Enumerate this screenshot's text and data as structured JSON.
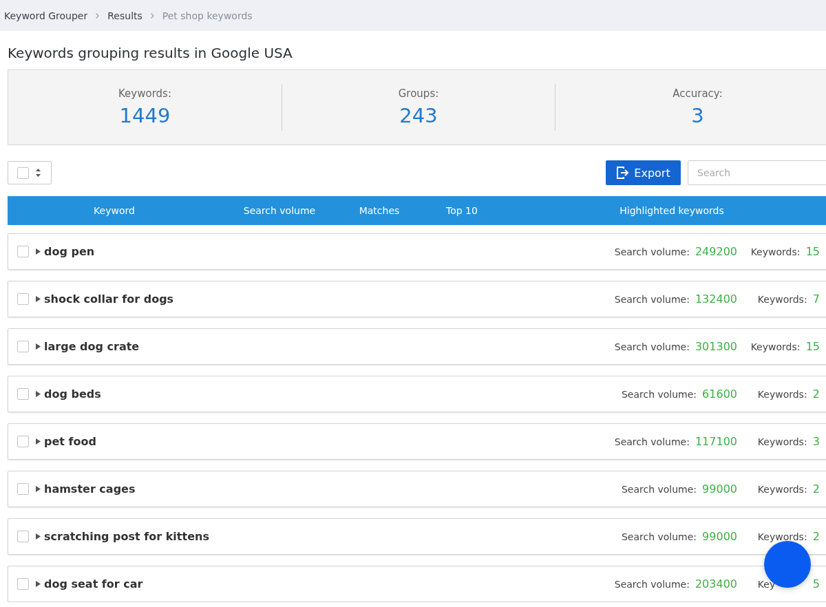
{
  "breadcrumbs": [
    {
      "label": "Keyword Grouper",
      "current": false
    },
    {
      "label": "Results",
      "current": false
    },
    {
      "label": "Pet shop keywords",
      "current": true
    }
  ],
  "title": "Keywords grouping results in Google USA",
  "stats": [
    {
      "label": "Keywords:",
      "value": "1449"
    },
    {
      "label": "Groups:",
      "value": "243"
    },
    {
      "label": "Accuracy:",
      "value": "3"
    }
  ],
  "toolbar": {
    "select_all": {
      "checked": false
    },
    "export_button": "Export",
    "search": {
      "placeholder": "Search"
    }
  },
  "table": {
    "columns": [
      "Keyword",
      "Search volume",
      "Matches",
      "Top 10",
      "Highlighted keywords"
    ],
    "rows": [
      {
        "keyword": "dog pen",
        "checked": false,
        "expanded": false,
        "volume_label": "Search volume:",
        "volume": "249200",
        "keywords_label": "Keywords:",
        "keywords": "15"
      },
      {
        "keyword": "shock collar for dogs",
        "checked": false,
        "expanded": false,
        "volume_label": "Search volume:",
        "volume": "132400",
        "keywords_label": "Keywords:",
        "keywords": "7"
      },
      {
        "keyword": "large dog crate",
        "checked": false,
        "expanded": false,
        "volume_label": "Search volume:",
        "volume": "301300",
        "keywords_label": "Keywords:",
        "keywords": "15"
      },
      {
        "keyword": "dog beds",
        "checked": false,
        "expanded": false,
        "volume_label": "Search volume:",
        "volume": "61600",
        "keywords_label": "Keywords:",
        "keywords": "2"
      },
      {
        "keyword": "pet food",
        "checked": false,
        "expanded": false,
        "volume_label": "Search volume:",
        "volume": "117100",
        "keywords_label": "Keywords:",
        "keywords": "3"
      },
      {
        "keyword": "hamster cages",
        "checked": false,
        "expanded": false,
        "volume_label": "Search volume:",
        "volume": "99000",
        "keywords_label": "Keywords:",
        "keywords": "2"
      },
      {
        "keyword": "scratching post for kittens",
        "checked": false,
        "expanded": false,
        "volume_label": "Search volume:",
        "volume": "99000",
        "keywords_label": "Keywords:",
        "keywords": "2"
      },
      {
        "keyword": "dog seat for car",
        "checked": false,
        "expanded": false,
        "volume_label": "Search volume:",
        "volume": "203400",
        "keywords_label": "Key",
        "keywords": "5"
      }
    ]
  },
  "floating_button": {
    "kind": "circle"
  }
}
